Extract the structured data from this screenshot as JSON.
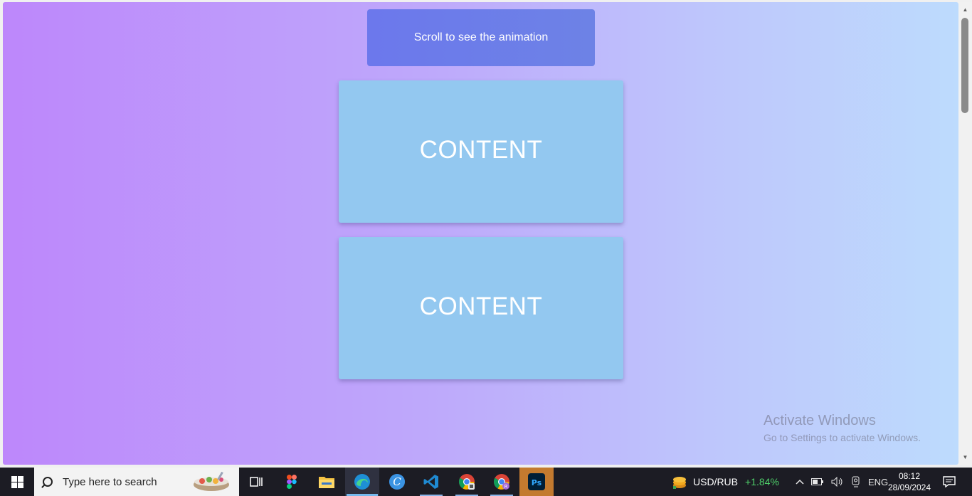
{
  "page": {
    "banner_text": "Scroll to see the animation",
    "cards": [
      {
        "label": "CONTENT"
      },
      {
        "label": "CONTENT"
      }
    ],
    "colors": {
      "gradient_start": "#bd87fb",
      "gradient_end": "#bddbfd",
      "banner": "#6c78ec",
      "card": "#93c8f0"
    }
  },
  "watermark": {
    "title": "Activate Windows",
    "subtitle": "Go to Settings to activate Windows."
  },
  "taskbar": {
    "search_placeholder": "Type here to search",
    "apps": [
      "task-view",
      "figma",
      "file-explorer",
      "edge",
      "canva",
      "vscode",
      "chrome",
      "chrome-profile",
      "photoshop"
    ],
    "photoshop_label": "Ps",
    "currency": {
      "pair": "USD/RUB",
      "change": "+1.84%"
    },
    "language": "ENG",
    "clock": {
      "time": "08:12",
      "date": "28/09/2024"
    }
  }
}
